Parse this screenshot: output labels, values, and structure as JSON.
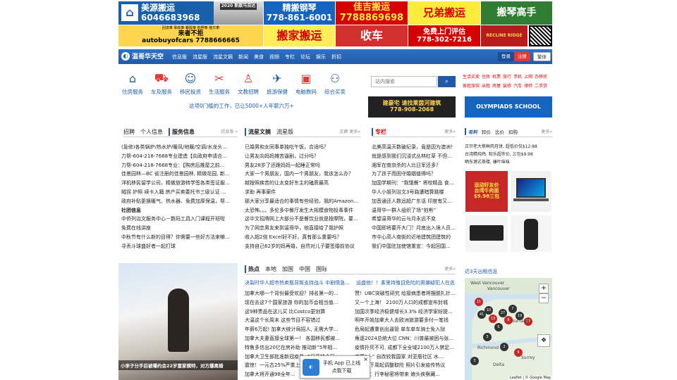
{
  "ads_row1": [
    {
      "text": "美源搬运\n6046683968",
      "sub": "2020 新款马自达",
      "bg": "#1a5faa",
      "fg": "#fff"
    },
    {
      "text": "精搬钢琴\n778-861-6001",
      "bg": "#1565c0",
      "fg": "#fff"
    },
    {
      "text": "佳吉搬运\n7788869698",
      "bg": "#d50000",
      "fg": "#ffeb3b"
    },
    {
      "text": "兄弟搬运",
      "bg": "#ffeb3b",
      "fg": "#d50000"
    },
    {
      "text": "搬琴高手",
      "bg": "#2e7d32",
      "fg": "#fff"
    }
  ],
  "ads_row2": [
    {
      "text": "来者不拒\nautobuyofcars 7788666665",
      "sub": "回流車 事故車 報廢車 抵押車 拖欠車",
      "bg": "#ffd54f",
      "fg": "#000"
    },
    {
      "text": "搬家搬运",
      "bg": "#ffee58",
      "fg": "#d50000"
    },
    {
      "text": "收车",
      "bg": "#d32f2f",
      "fg": "#fff"
    },
    {
      "text": "免费上门评估\n778-302-7216",
      "bg": "#d50000",
      "fg": "#fff"
    },
    {
      "text": "RECLINE RIDGE",
      "bg": "#b71c1c",
      "fg": "#ffd54f"
    }
  ],
  "nav": {
    "logo": "温哥华天空",
    "links": [
      "信息版",
      "流星版",
      "流星文摘",
      "新闻",
      "美食",
      "视频",
      "专栏",
      "论坛",
      "娱乐",
      "折扣"
    ],
    "login": "登录",
    "register": "注册",
    "mark": "繁体"
  },
  "categories": [
    {
      "label": "住房服务",
      "icon": "🏠"
    },
    {
      "label": "车及服务",
      "icon": "🚗"
    },
    {
      "label": "移民投资",
      "icon": "👥"
    },
    {
      "label": "生活服务",
      "icon": "🧰"
    },
    {
      "label": "文教招聘",
      "icon": "🧑"
    },
    {
      "label": "旅游保健",
      "icon": "💼"
    },
    {
      "label": "电脑数码",
      "icon": "💻"
    },
    {
      "label": "综合买卖",
      "icon": "🤲"
    }
  ],
  "search": {
    "placeholder": "站内搜索"
  },
  "hot_links": [
    "生活买卖",
    "住房",
    "机票",
    "旅行",
    "手机",
    "上网",
    "办移民",
    "家庭旅馆",
    "出租",
    "房屋",
    "装修",
    "汽车",
    "律师",
    "二手货"
  ],
  "promo": "这项0门槛的工作，已让5000+人年薪六万+",
  "banner_mid": {
    "text": "建豪宅 请找莱茵河建筑\n778-908-2068"
  },
  "banner_right": {
    "text": "OLYMPIADS SCHOOL"
  },
  "sec1": {
    "tabs": [
      "招聘",
      "个人信息",
      "服务信息"
    ],
    "more": "信息版 »"
  },
  "sec1_list": [
    "(急修)各类锅炉/热水炉/暖风/地暖/空调/水龙头...",
    "力帮-604-218-7668专业建造【向政府申请合...",
    "力帮-604-218-7668专业：【购房后推屋之前...",
    "佳景园林—BC 省注册的佳景园林, 精做花园, 新...",
    "洋机移民留学公司，精做旅游转学签各类签证服...",
    "贼拐 护照 续卡入籍 房产买卖委托书三级认证 ...",
    "政府补贴更换暖气、热水器、免费加厚保温，帮..."
  ],
  "sec1_sub": "社团信息",
  "sec1_list2": [
    "中侨列治文服务中心－数码工具入门课程开班啦",
    "免费在线讲座",
    "中秋节有什么新的目得？你需要一些好方法来嘛...",
    "寻丢斗球盛好者一起打球"
  ],
  "sec2": {
    "tabs": [
      "流星文摘",
      "流星版"
    ],
    "more": "文摘 更多»"
  },
  "sec2_list": [
    "已婚男和女同事单独吃午饭，合适吗？",
    "让男友向妈妈摊苦逼剧，过分吗？",
    "男友28岁了还跟妈妈一起睡正常吗",
    "大家一个男朋友，国内一个男朋友，我该怎么办？",
    "越按照疾苦的让太变好东主的磕质最高",
    "求助 再事案件",
    "那大家分享最适合的事情有些经验。我的Amazon...",
    "太恐怖。。。多伦多中餐厅发生大规模食物投毒事件",
    "这中文招牌网上大部分不是餐饮业就是按摩院，要么...",
    "为了网恋男友来到温哥华，他直接给了我护照",
    "收入超2倍 Excel好不好，真有那么重要吗？",
    "支持自己62岁的妈再婚，自然对儿子要签婚前协议"
  ],
  "sec3": {
    "tab": "专栏",
    "more": "更多»"
  },
  "sec3_list": [
    "北美高温天数破纪录，竟是因为澳洲！",
    "就是感到我们沉浸式丛林红草 不但出...",
    "湘军在南京杀的人比日军还多？",
    "为了孩子而困守婚姻值得吗？",
    "加国学期刊：“我饿餐” 将校精品 食保全",
    "华人小姐列治文3号路遭暗算跳楼",
    "加音通还人数远超广东话 印度有又霸了",
    "温哥华一群人组织了场“拍熊”",
    "希望温哥华的云与月永远不变",
    "中国即将要开大门？月底出入境人员...",
    "市中心高人南街的近地建筑团建筑的",
    "我们中国驻加使馆重宣：今起回国..."
  ],
  "sec4": {
    "tabs": [
      "有料",
      "较价",
      "比价",
      "扣购"
    ],
    "more": "更多»"
  },
  "sec4_text": [
    "正宗老大焦鲜肉月饼, 超低价仅$12.88",
    "台湾精炖鸡, 软乐超市价, 三包$9.98",
    "晒东港式茶楼, 康叶味味"
  ],
  "sec4_promo": "运动好友价\n台湾牛肉面\n$9.98三包",
  "news": {
    "tabs": [
      "热点",
      "本地",
      "加国",
      "中国",
      "国际"
    ],
    "more": "更多»"
  },
  "news_top": [
    "决裂时华人超市热卖瓶背叛支持战斗 中剧情急...",
    "运盛他！！素里持殖目危险的男嫌疑犯人在逃"
  ],
  "news_list_left": [
    "加拿大哪一个背份最受欢迎？排名第一的...",
    "现在去这7个国家旅游 你的加币会相当值...",
    "这9种票品在这儿买 比Costco更划算",
    "大温这个长周末 这些节目不容错过",
    "年薪6万起! 加拿大统计局招人, 无需大学...",
    "加拿大夫妻直接全球第一！ 各国移民都被...",
    "特鲁多信出20亿在房补助 推动新“5年相...",
    "加拿大卫生部批准新冠疫苗: 9月开放全民...",
    "震惊！一元古25%严重上涨 商家最怒...",
    "加拿大将开通98全年..."
  ],
  "news_list_right": [
    "赞！UBC突破性研究 给接病患者将摆脱扎针...",
    "又一个上海！ 2100万人口的成都宣布封城",
    "加国次季经济稳健增长3.3% 经济学家纷提...",
    "明年开始加拿大人去欧洲旅游要多付一笔钱",
    "危局起遭重创出逼管 单车单车骑士免入狱",
    "角逐2024总统大位 CNN：川普最被困与张...",
    "疫情扑死不可, 成都下全全域2100万人禁足...",
    "中国“十” 自改较我国家 对亚裔社区 水...",
    "加拿大下周起调整取险 照片引发疫传热议",
    "温哥华：行李秘密将带来 娘头疾察藏..."
  ],
  "photo_caption": "小李子分手后被曝约会22岁富家模特，对方爆离婚",
  "app_popup": {
    "text": "手机 App 已上线\n点我下载"
  },
  "map": {
    "title": "近3天出租信息",
    "attrib": "Leaflet | © Google Map",
    "labels": [
      "West Vancouver",
      "Vancouver",
      "Burnaby",
      "Richmond",
      "Surrey",
      "Delta"
    ]
  },
  "map_pins": [
    "11",
    "10",
    "41",
    "13",
    "27",
    "7",
    "8",
    "19",
    "5",
    "17",
    "3",
    "2",
    "9",
    "3"
  ]
}
